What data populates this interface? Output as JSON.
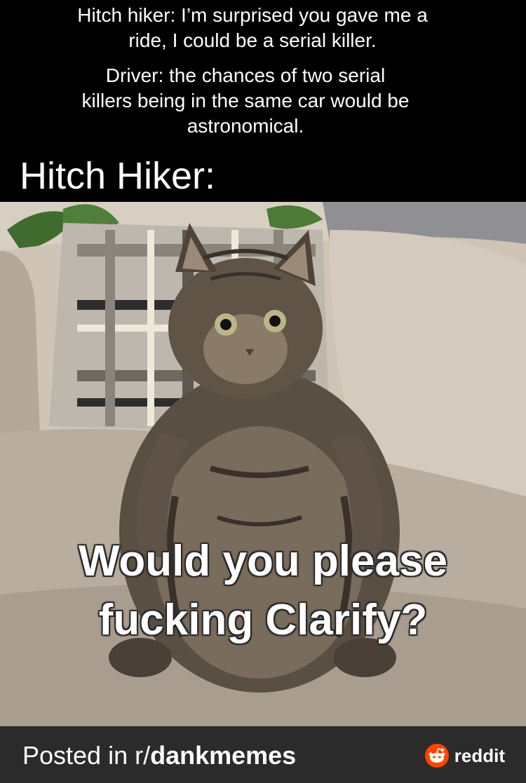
{
  "top_text": {
    "paragraph1_line1": "Hitch hiker: I’m surprised you gave me a",
    "paragraph1_line2": "ride, I could be a serial killer.",
    "paragraph2_line1": "Driver: the chances of two serial",
    "paragraph2_line2": "killers being in the same car would be",
    "paragraph2_line3": "astronomical.",
    "label": "Hitch Hiker:"
  },
  "image": {
    "subject": "cat-icon",
    "caption_line1": "Would you please",
    "caption_line2": "fucking Clarify?"
  },
  "footer": {
    "posted_prefix": "Posted in r/",
    "subreddit": "dankmemes",
    "brand": "reddit",
    "brand_color": "#ff4500",
    "bar_color": "#2b2b2b"
  }
}
